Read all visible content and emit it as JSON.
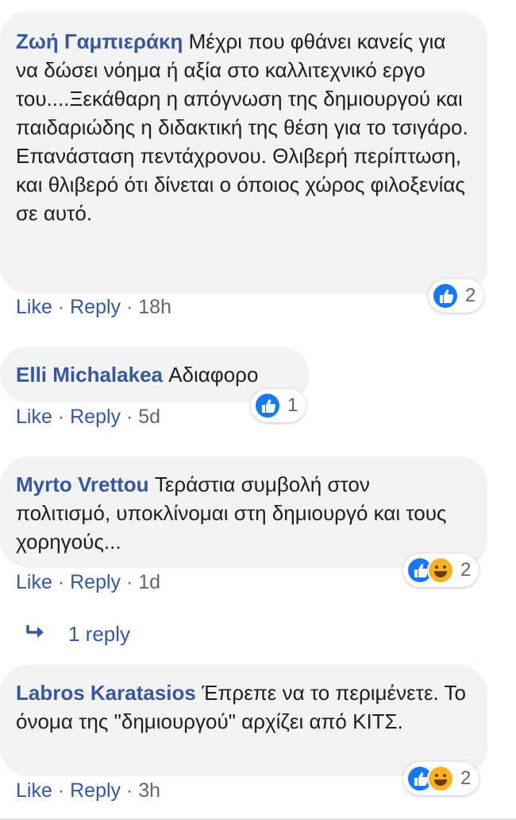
{
  "comments": [
    {
      "author": "Ζωή Γαμπιεράκη",
      "text": "Μέχρι που φθάνει κανείς για να δώσει νόημα ή αξία στο καλλιτεχνικό εργο του....Ξεκάθαρη η απόγνωση της δημιουργού και παιδαριώδης η διδακτική της θέση για το τσιγάρο. Επανάσταση πεντάχρονου. Θλιβερή περίπτωση, και θλιβερό ότι δίνεται ο όποιος χώρος φιλοξενίας σε αυτό.",
      "like": "Like",
      "reply": "Reply",
      "time": "18h",
      "reactions": [
        "like"
      ],
      "reaction_count": "2"
    },
    {
      "author": "Elli Michalakea",
      "text": "Αδιαφορο",
      "like": "Like",
      "reply": "Reply",
      "time": "5d",
      "reactions": [
        "like"
      ],
      "reaction_count": "1"
    },
    {
      "author": "Myrto Vrettou",
      "text": "Τεράστια συμβολή στον πολιτισμό, υποκλίνομαι στη δημιουργό και τους χορηγούς...",
      "like": "Like",
      "reply": "Reply",
      "time": "1d",
      "reactions": [
        "like",
        "haha"
      ],
      "reaction_count": "2"
    },
    {
      "author": "Labros Karatasios",
      "text": "Έπρεπε να το περιμένετε. Το όνομα της \"δημιουργού\" αρχίζει από ΚΙΤΣ.",
      "like": "Like",
      "reply": "Reply",
      "time": "3h",
      "reactions": [
        "like",
        "haha"
      ],
      "reaction_count": "2"
    }
  ],
  "replies_link": "1 reply",
  "separator": "·",
  "colors": {
    "author": "#385898",
    "bubble": "#f2f3f5",
    "meta": "#606770",
    "like_blue": "#1877f2",
    "haha_yellow": "#f7b125"
  }
}
